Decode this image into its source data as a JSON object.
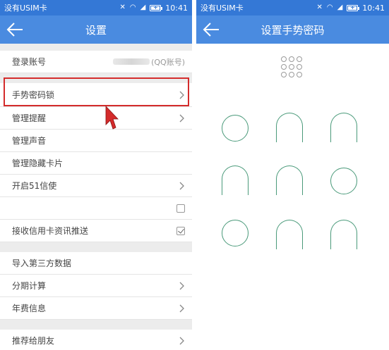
{
  "left": {
    "status": {
      "carrier": "没有USIM卡",
      "time": "10:41"
    },
    "nav": {
      "title": "设置"
    },
    "rows": {
      "account_label": "登录账号",
      "account_value": "(QQ账号)",
      "gesture_lock": "手势密码锁",
      "manage_reminder": "管理提醒",
      "manage_sound": "管理声音",
      "manage_hidden_cards": "管理隐藏卡片",
      "enable_51xinshi": "开启51信使",
      "push_credit_news": "接收信用卡资讯推送",
      "import_third_party": "导入第三方数据",
      "installment_calc": "分期计算",
      "annual_fee": "年费信息",
      "recommend_friends": "推荐给朋友"
    },
    "checkbox_states": {
      "row_blank": false,
      "push_credit_news": true
    }
  },
  "right": {
    "status": {
      "carrier": "没有USIM卡",
      "time": "10:41"
    },
    "nav": {
      "title": "设置手势密码"
    }
  },
  "colors": {
    "status_bar": "#3478d6",
    "nav_bar": "#4a8be0",
    "highlight_border": "#d42b2b",
    "gesture_ring": "#4a9a7a"
  },
  "icons": [
    "back-arrow-icon",
    "chevron-right-icon",
    "wifi-icon",
    "signal-icon",
    "battery-icon",
    "mute-icon",
    "checkbox-icon",
    "cursor-arrow-icon"
  ]
}
